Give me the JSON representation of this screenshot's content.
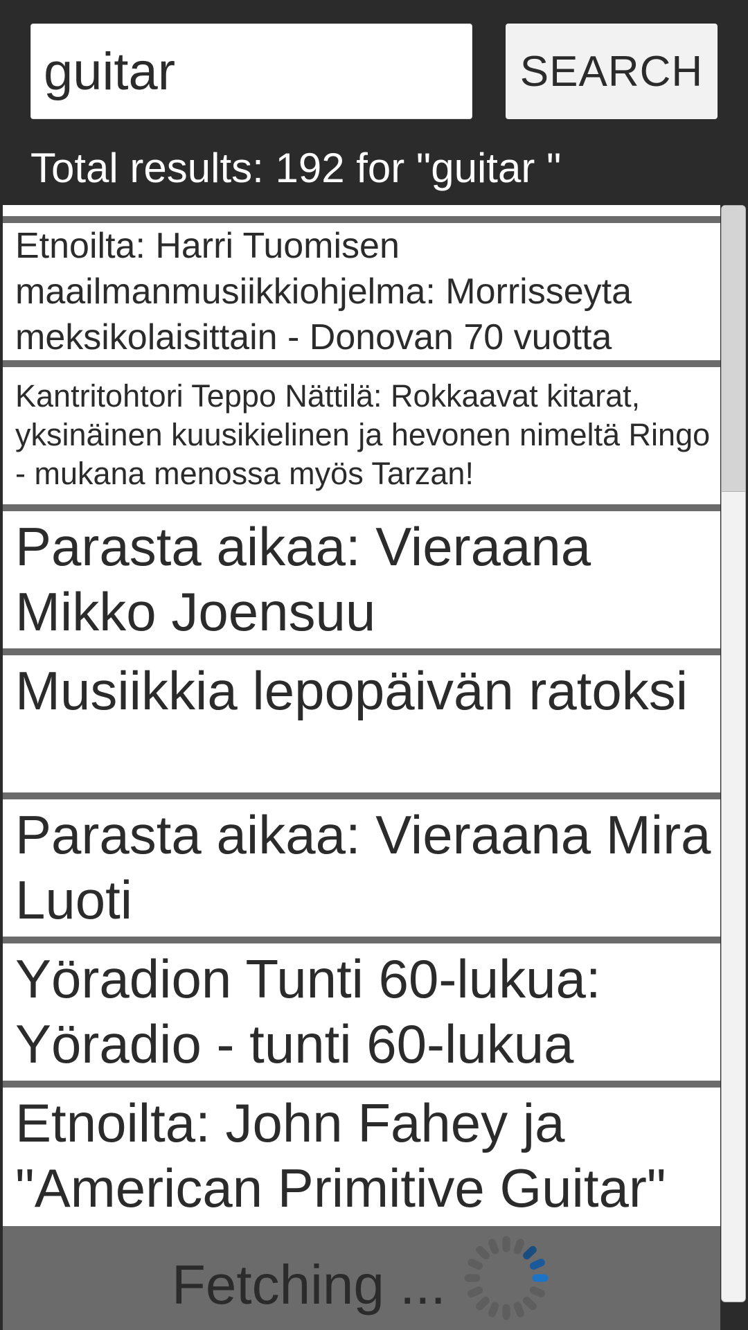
{
  "search": {
    "value": "guitar",
    "placeholder": "",
    "button_label": "SEARCH"
  },
  "results": {
    "summary": "Total results: 192 for \"guitar \"",
    "items": [
      {
        "title": "Etnoilta: Harri Tuomisen maailmanmusiikkiohjelma: Morrisseyta meksikolaisittain - Donovan 70 vuotta"
      },
      {
        "title": "Kantritohtori Teppo Nättilä: Rokkaavat kitarat, yksinäinen kuusikielinen ja hevonen nimeltä Ringo - mukana menossa myös Tarzan!"
      },
      {
        "title": "Parasta aikaa: Vieraana Mikko Joensuu"
      },
      {
        "title": "Musiikkia lepopäivän ratoksi"
      },
      {
        "title": "Parasta aikaa: Vieraana Mira Luoti"
      },
      {
        "title": "Yöradion Tunti 60-lukua: Yöradio - tunti 60-lukua"
      },
      {
        "title": "Etnoilta: John Fahey ja \"American Primitive Guitar\""
      }
    ]
  },
  "loader": {
    "label": "Fetching ...",
    "icon": "spinner-icon"
  },
  "colors": {
    "header_bg": "#2b2b2b",
    "list_divider": "#6b6b6b",
    "spinner_active": "#1a5a9a"
  }
}
